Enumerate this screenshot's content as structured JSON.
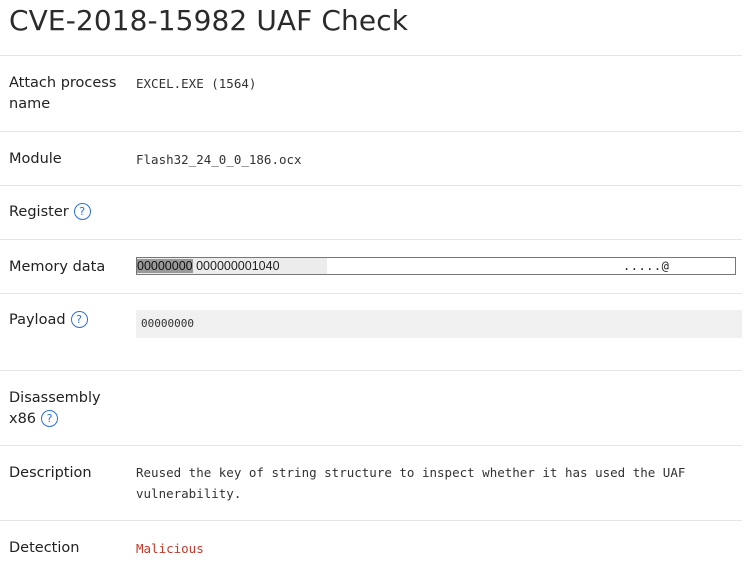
{
  "page": {
    "title": "CVE-2018-15982 UAF Check"
  },
  "fields": {
    "attach_process": {
      "label": "Attach process name",
      "value": "EXCEL.EXE (1564)"
    },
    "module": {
      "label": "Module",
      "value": "Flash32_24_0_0_186.ocx"
    },
    "register": {
      "label": "Register",
      "help": "?",
      "value": ""
    },
    "memory": {
      "label": "Memory data",
      "hex_highlight": "00000000",
      "hex_rest": " 000000001040",
      "ascii": ".....@"
    },
    "payload": {
      "label": "Payload",
      "help": "?",
      "value": "00000000"
    },
    "disassembly": {
      "label_line1": "Disassembly",
      "label_line2": "x86",
      "help": "?",
      "value": ""
    },
    "description": {
      "label": "Description",
      "line1": "Reused the key of string structure to inspect whether it has used the UAF",
      "line2": "vulnerability."
    },
    "detection": {
      "label": "Detection",
      "value": "Malicious",
      "value_color": "#c0392b"
    }
  },
  "colors": {
    "help_icon": "#2f6fd6",
    "divider": "#e6e6e6"
  },
  "icons": {
    "help": "question-circle-icon"
  }
}
